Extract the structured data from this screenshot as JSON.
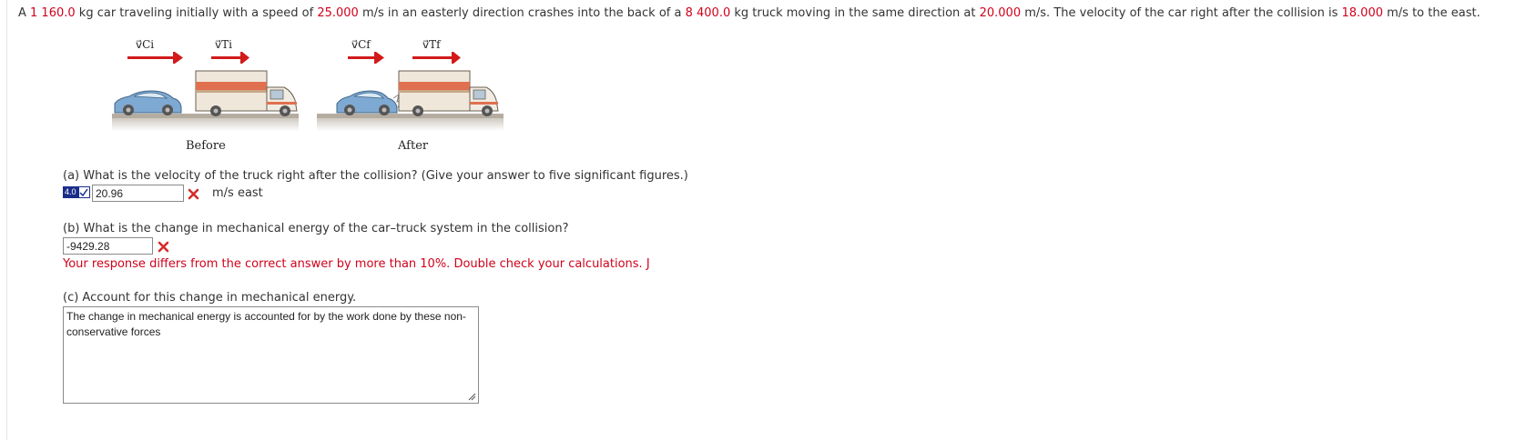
{
  "problem": {
    "t1": "A ",
    "car_mass": "1 160.0",
    "t2": " kg car traveling initially with a speed of ",
    "car_speed": "25.000",
    "t3": " m/s in an easterly direction crashes into the back of a ",
    "truck_mass": "8 400.0",
    "t4": " kg truck moving in the same direction at ",
    "truck_speed": "20.000",
    "t5": " m/s. The velocity of the car right after the collision is ",
    "car_final": "18.000",
    "t6": " m/s to the east."
  },
  "figure": {
    "vectors": [
      "v⃗Ci",
      "v⃗Ti",
      "v⃗Cf",
      "v⃗Tf"
    ],
    "before_label": "Before",
    "after_label": "After"
  },
  "part_a": {
    "question": "(a) What is the velocity of the truck right after the collision? (Give your answer to five significant figures.)",
    "badge": "4.0",
    "answer": "20.96",
    "unit": "m/s east"
  },
  "part_b": {
    "question": "(b) What is the change in mechanical energy of the car–truck system in the collision?",
    "answer": "-9429.28",
    "feedback": "Your response differs from the correct answer by more than 10%. Double check your calculations. J"
  },
  "part_c": {
    "question": "(c) Account for this change in mechanical energy.",
    "answer": "The change in mechanical energy is accounted for by the work done by these non-conservative forces"
  },
  "colors": {
    "accent_red": "#d0021b",
    "badge_blue": "#1a2d8a"
  }
}
